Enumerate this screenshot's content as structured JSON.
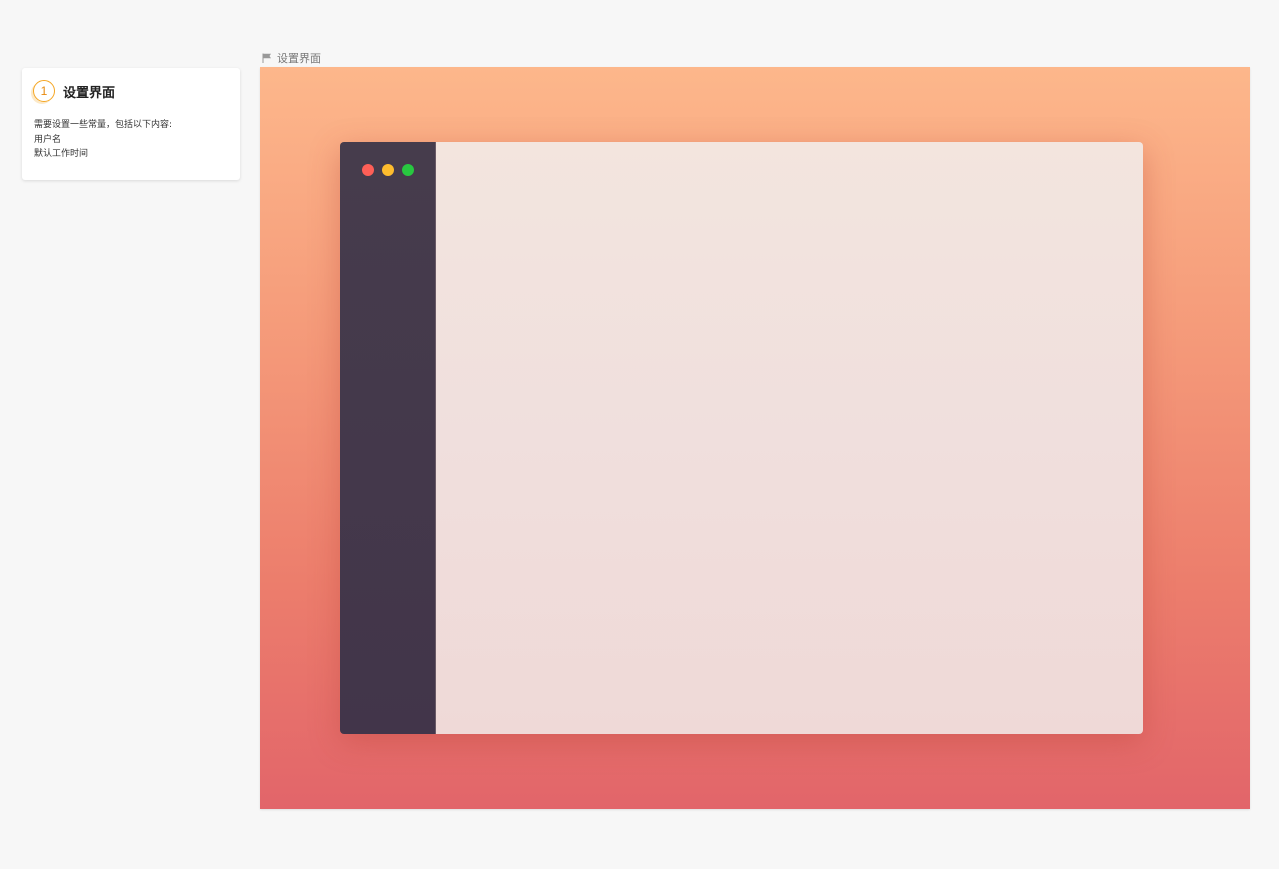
{
  "note": {
    "step": "1",
    "title": "设置界面",
    "lines": [
      "需要设置一些常量，包括以下内容:",
      "用户名",
      "默认工作时间"
    ]
  },
  "frame": {
    "label": "设置界面",
    "icon": "flag-icon"
  },
  "colors": {
    "close": "#fe5f57",
    "minimize": "#febc2e",
    "maximize": "#28c840"
  }
}
